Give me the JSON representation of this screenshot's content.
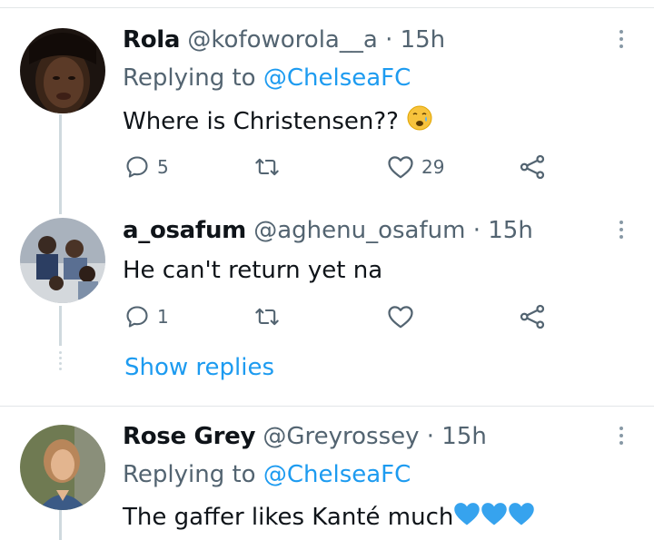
{
  "tweets": [
    {
      "name": "Rola",
      "handle": "@kofoworola__a",
      "time": "· 15h",
      "replying_label": "Replying to",
      "replying_handle": "@ChelseaFC",
      "text": "Where is Christensen??",
      "replies": "5",
      "retweets": "",
      "likes": "29"
    },
    {
      "name": "a_osafum",
      "handle": "@aghenu_osafum",
      "time": "· 15h",
      "text": "He can't return yet na",
      "replies": "1",
      "retweets": "",
      "likes": ""
    },
    {
      "name": "Rose Grey",
      "handle": "@Greyrossey",
      "time": "· 15h",
      "replying_label": "Replying to",
      "replying_handle": "@ChelseaFC",
      "text": "The gaffer likes Kanté much"
    }
  ],
  "show_replies_label": "Show replies",
  "colors": {
    "accent": "#1d9bf0",
    "secondary_text": "#536471",
    "heart_emoji": "#36a3ee"
  },
  "icons": [
    "reply-icon",
    "retweet-icon",
    "like-icon",
    "share-icon",
    "more-icon",
    "crying-face-emoji",
    "blue-heart-emoji"
  ]
}
